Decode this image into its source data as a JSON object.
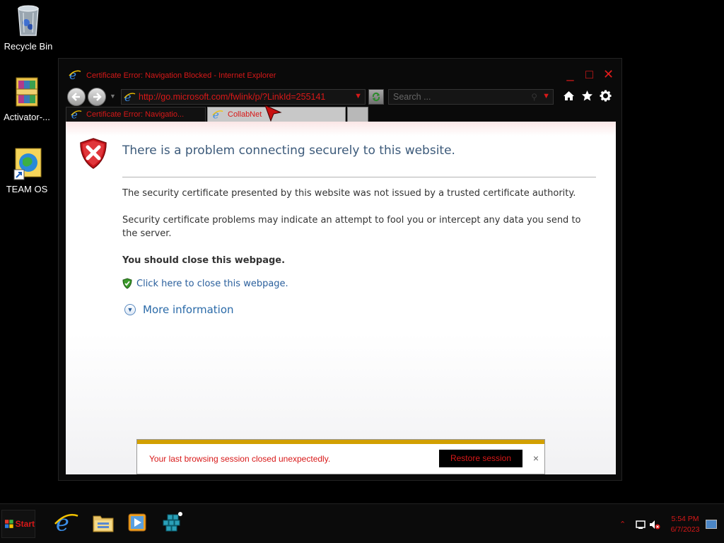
{
  "desktop": {
    "icons": [
      {
        "label": "Recycle Bin",
        "icon": "recycle-bin-icon"
      },
      {
        "label": "Activator-...",
        "icon": "winrar-archive-icon"
      },
      {
        "label": "TEAM OS",
        "icon": "globe-shortcut-icon"
      }
    ]
  },
  "window": {
    "title": "Certificate Error: Navigation Blocked - Internet Explorer",
    "controls": {
      "minimize": "_",
      "maximize": "□",
      "close": "✕"
    },
    "address": {
      "url": "http://go.microsoft.com/fwlink/p/?LinkId=255141"
    },
    "search": {
      "placeholder": "Search ..."
    },
    "tabs": [
      {
        "label": "Certificate Error: Navigatio...",
        "active": true
      },
      {
        "label": "CollabNet",
        "active": false
      }
    ]
  },
  "page": {
    "heading": "There is a problem connecting securely to this website.",
    "para1": "The security certificate presented by this website was not issued by a trusted certificate authority.",
    "para2": "Security certificate problems may indicate an attempt to fool you or intercept any data you send to the server.",
    "recommendation": "You should close this webpage.",
    "close_link": "Click here to close this webpage.",
    "more_info": "More information"
  },
  "notification": {
    "message": "Your last browsing session closed unexpectedly.",
    "button": "Restore session",
    "close": "×"
  },
  "taskbar": {
    "start_label": "Start",
    "apps": [
      "internet-explorer-icon",
      "file-explorer-icon",
      "media-player-icon",
      "cube-app-icon"
    ],
    "clock": {
      "time": "5:54 PM",
      "date": "6/7/2023"
    }
  },
  "colors": {
    "accent": "#d81818",
    "link": "#2a5f9c",
    "heading": "#3c5a7a",
    "notify_bar": "#d2a000"
  }
}
